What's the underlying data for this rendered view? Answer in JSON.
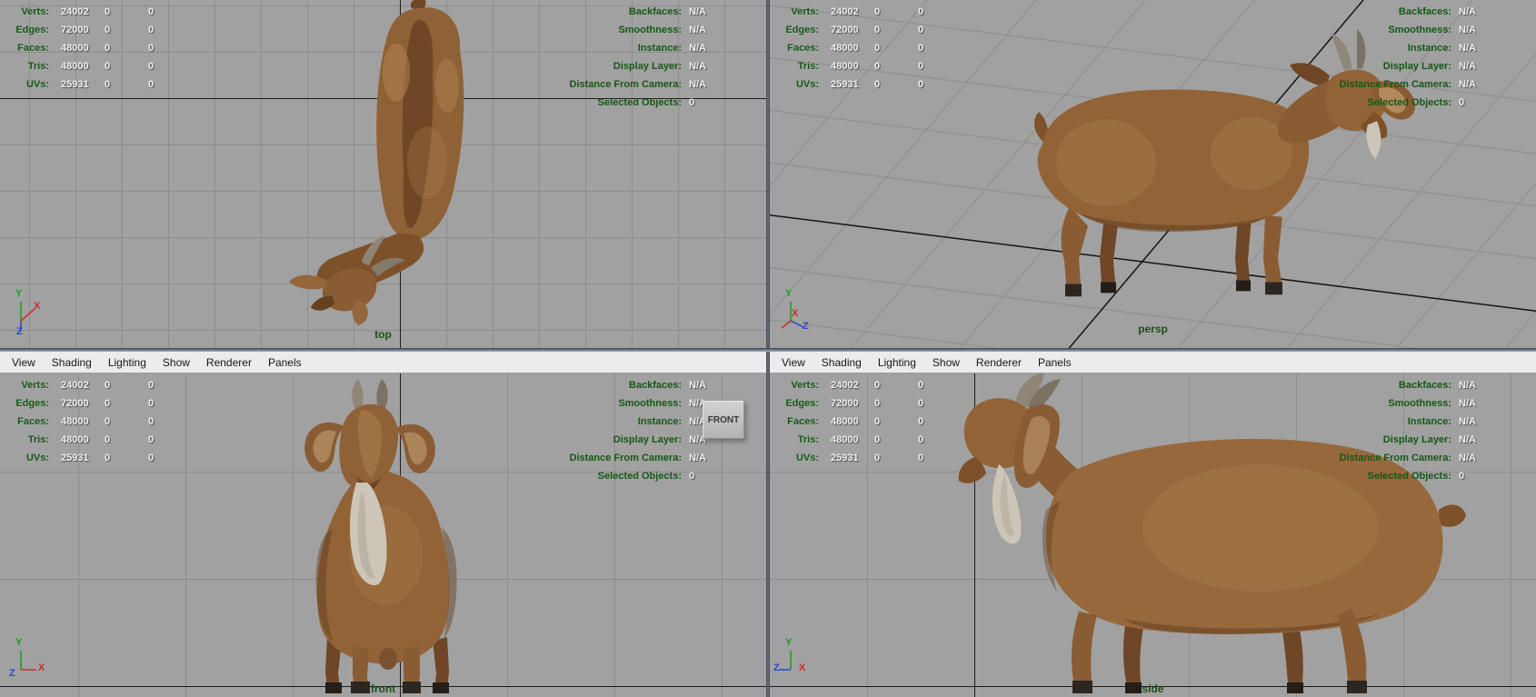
{
  "hud": {
    "left_rows": [
      {
        "label": "Verts:",
        "values": [
          "24002",
          "0",
          "0"
        ]
      },
      {
        "label": "Edges:",
        "values": [
          "72000",
          "0",
          "0"
        ]
      },
      {
        "label": "Faces:",
        "values": [
          "48000",
          "0",
          "0"
        ]
      },
      {
        "label": "Tris:",
        "values": [
          "48000",
          "0",
          "0"
        ]
      },
      {
        "label": "UVs:",
        "values": [
          "25931",
          "0",
          "0"
        ]
      }
    ],
    "right_rows": [
      {
        "label": "Backfaces:",
        "value": "N/A"
      },
      {
        "label": "Smoothness:",
        "value": "N/A"
      },
      {
        "label": "Instance:",
        "value": "N/A"
      },
      {
        "label": "Display Layer:",
        "value": "N/A"
      },
      {
        "label": "Distance From Camera:",
        "value": "N/A"
      },
      {
        "label": "Selected Objects:",
        "value": "0"
      }
    ]
  },
  "menu_bar": {
    "items": [
      "View",
      "Shading",
      "Lighting",
      "Show",
      "Renderer",
      "Panels"
    ]
  },
  "viewports": {
    "top": {
      "label": "top"
    },
    "persp": {
      "label": "persp"
    },
    "front": {
      "label": "front",
      "overlay_plate": "FRONT"
    },
    "side": {
      "label": "side"
    }
  },
  "axis_letters": {
    "x": "X",
    "y": "Y",
    "z": "Z"
  },
  "colors": {
    "viewport_bg": "#a1a1a1",
    "grid_line": "#8d8d8d",
    "axis_line_black": "#1c1c1c",
    "hud_label_green": "#155815",
    "hud_value_white": "#f0f0f0",
    "view_label_green": "#1e4f1e",
    "axis_x_red": "#cc2d2d",
    "axis_y_green": "#18a018",
    "axis_z_blue": "#2b49c8",
    "goat_brown": "#916336",
    "menu_bar_bg": "#ececec"
  }
}
